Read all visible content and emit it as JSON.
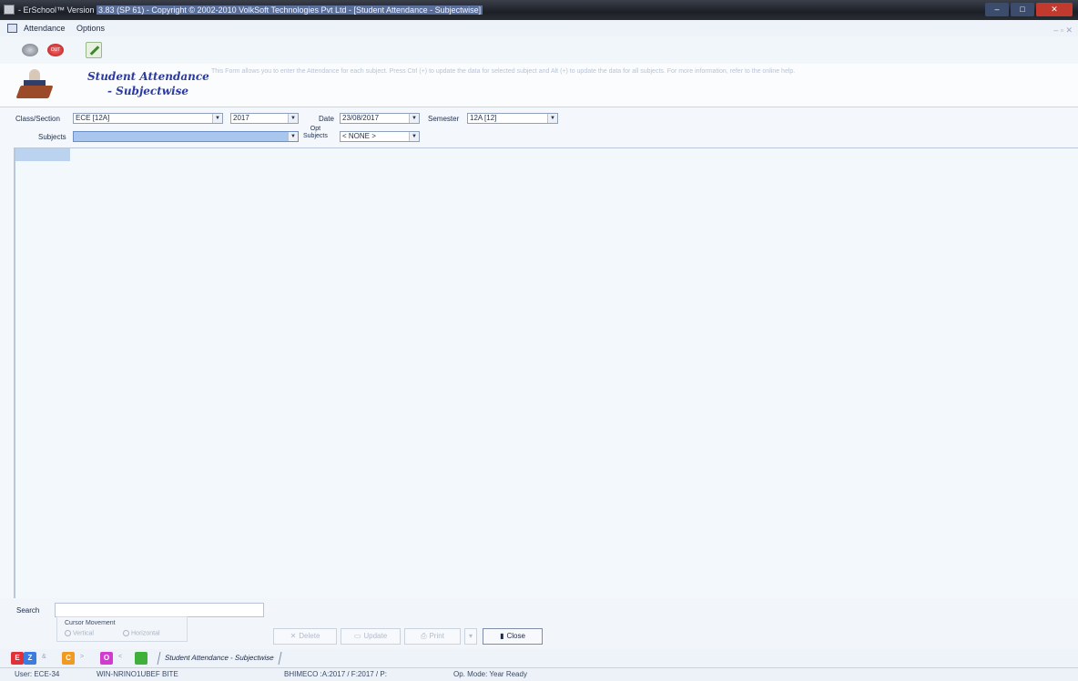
{
  "window": {
    "title_prefix": "- ErSchool™ Version ",
    "title_highlight": "3.83 (SP 61) - Copyright © 2002-2010 VolkSoft Technologies Pvt Ltd - [Student Attendance - Subjectwise]",
    "min": "–",
    "max": "□",
    "close": "✕"
  },
  "menu": {
    "items": [
      "Attendance",
      "Options"
    ],
    "mdi_controls": "– ▫ ✕"
  },
  "toolbar": {
    "out_label": "OUT"
  },
  "header": {
    "title_line1": "Student Attendance",
    "title_line2": "- Subjectwise",
    "help": "This Form allows you to enter the Attendance for each subject. Press Ctrl (+) to update the data for selected subject and Alt (+) to update the data for all subjects. For more information, refer to the online help."
  },
  "filters": {
    "class_label": "Class/Section",
    "class_value": "ECE [12A]",
    "year_value": "2017",
    "date_label": "Date",
    "date_value": "23/08/2017",
    "semester_label": "Semester",
    "semester_value": "12A [12]",
    "subjects_label": "Subjects",
    "subjects_value": "",
    "opt_label_line1": "Opt",
    "opt_label_line2": "Subjects",
    "opt_value": "< NONE >"
  },
  "bottom": {
    "search_label": "Search",
    "cursor_label": "Cursor Movement",
    "radio_vertical": "Vertical",
    "radio_horizontal": "Horizontal",
    "buttons": {
      "delete": "Delete",
      "update": "Update",
      "print": "Print",
      "close": "Close"
    }
  },
  "taskbar": {
    "tab": "Student Attendance - Subjectwise"
  },
  "status": {
    "user": "User: ECE-34",
    "machine": "WIN-NRINO1UBEF BITE",
    "session": "BHIMECO :A:2017 / F:2017 / P:",
    "mode": "Op. Mode: Year Ready"
  }
}
